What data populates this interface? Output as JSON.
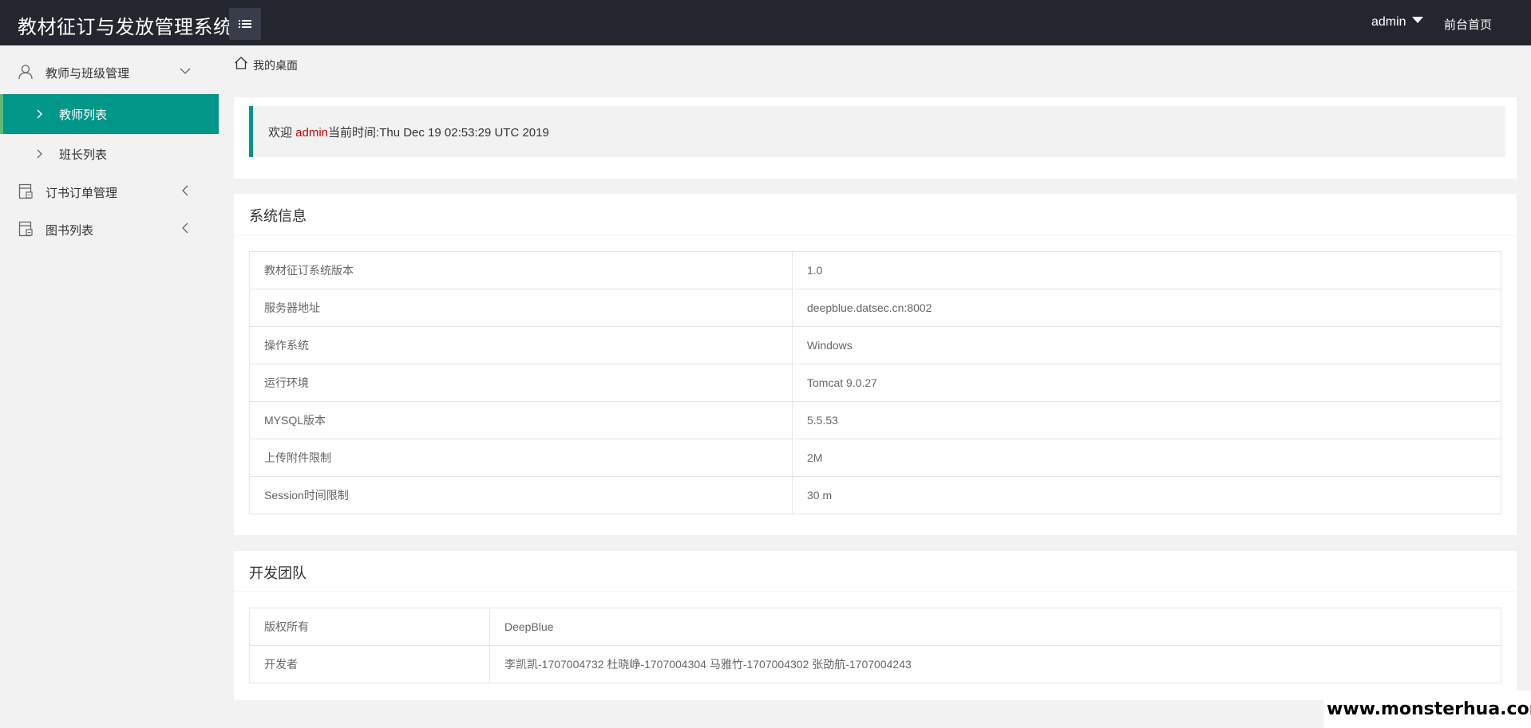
{
  "header": {
    "title": "教材征订与发放管理系统",
    "user": "admin",
    "front_page_link": "前台首页"
  },
  "sidebar": {
    "groups": [
      {
        "label": "教师与班级管理",
        "icon": "user-icon",
        "expanded": true,
        "items": [
          {
            "label": "教师列表",
            "active": true
          },
          {
            "label": "班长列表",
            "active": false
          }
        ]
      },
      {
        "label": "订书订单管理",
        "icon": "form-icon",
        "expanded": false
      },
      {
        "label": "图书列表",
        "icon": "form-icon",
        "expanded": false
      }
    ]
  },
  "breadcrumb": {
    "label": "我的桌面"
  },
  "welcome": {
    "prefix": "欢迎 ",
    "user": "admin",
    "time_label": "当前时间:",
    "time": "Thu Dec 19 02:53:29 UTC 2019"
  },
  "system_info": {
    "title": "系统信息",
    "rows": [
      {
        "key": "教材征订系统版本",
        "value": "1.0"
      },
      {
        "key": "服务器地址",
        "value": "deepblue.datsec.cn:8002"
      },
      {
        "key": "操作系统",
        "value": "Windows"
      },
      {
        "key": "运行环境",
        "value": "Tomcat 9.0.27"
      },
      {
        "key": "MYSQL版本",
        "value": "5.5.53"
      },
      {
        "key": "上传附件限制",
        "value": "2M"
      },
      {
        "key": "Session时间限制",
        "value": "30 m"
      }
    ]
  },
  "dev_team": {
    "title": "开发团队",
    "rows": [
      {
        "key": "版权所有",
        "value": "DeepBlue"
      },
      {
        "key": "开发者",
        "value": "李凯凯-1707004732 杜晓峥-1707004304 马雅竹-1707004302 张劭航-1707004243"
      }
    ]
  },
  "watermark": "www.monsterhua.com",
  "colors": {
    "header_bg": "#23262e",
    "accent": "#009688",
    "highlight": "#cc0000",
    "page_bg": "#f2f2f2"
  }
}
